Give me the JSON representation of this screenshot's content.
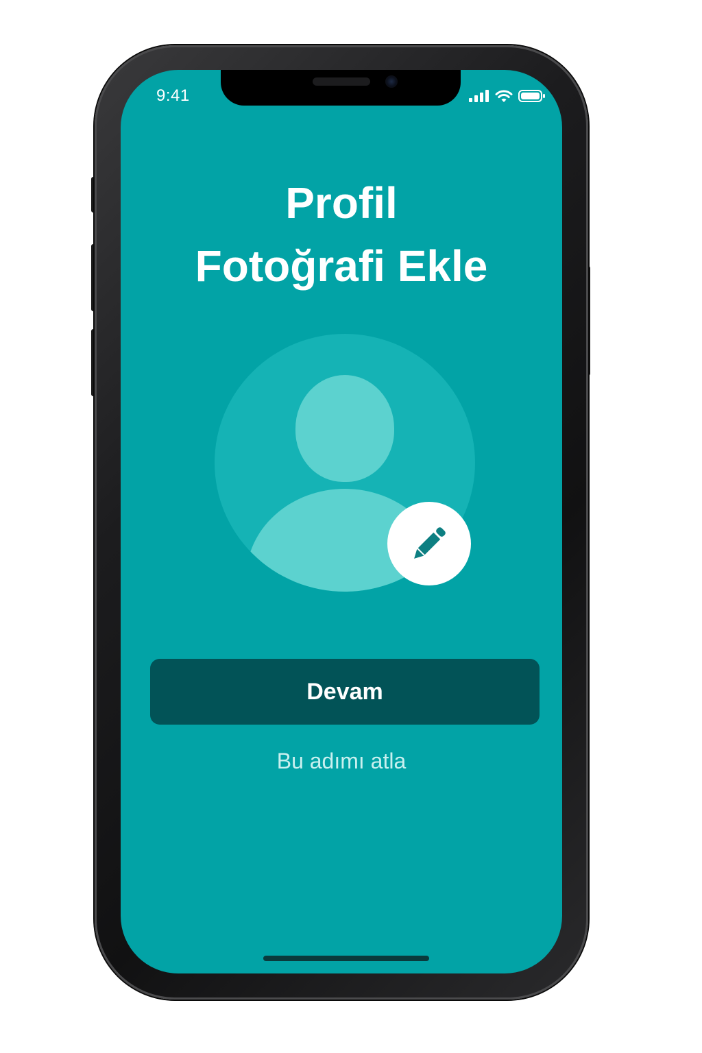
{
  "status_bar": {
    "time": "9:41",
    "icons": [
      "cellular-signal-icon",
      "wifi-icon",
      "battery-icon"
    ]
  },
  "header": {
    "title_line1": "Profil",
    "title_line2": "Fotoğrafi Ekle"
  },
  "avatar": {
    "placeholder_icon": "user-silhouette-icon",
    "edit_icon": "pencil-icon"
  },
  "actions": {
    "continue_label": "Devam",
    "skip_label": "Bu adımı atla"
  },
  "colors": {
    "screen_background": "#02a3a6",
    "avatar_circle": "#15b3b5",
    "avatar_figure": "#5cd2cf",
    "primary_button": "#025357",
    "edit_badge": "#ffffff",
    "pencil": "#0d7f82"
  }
}
